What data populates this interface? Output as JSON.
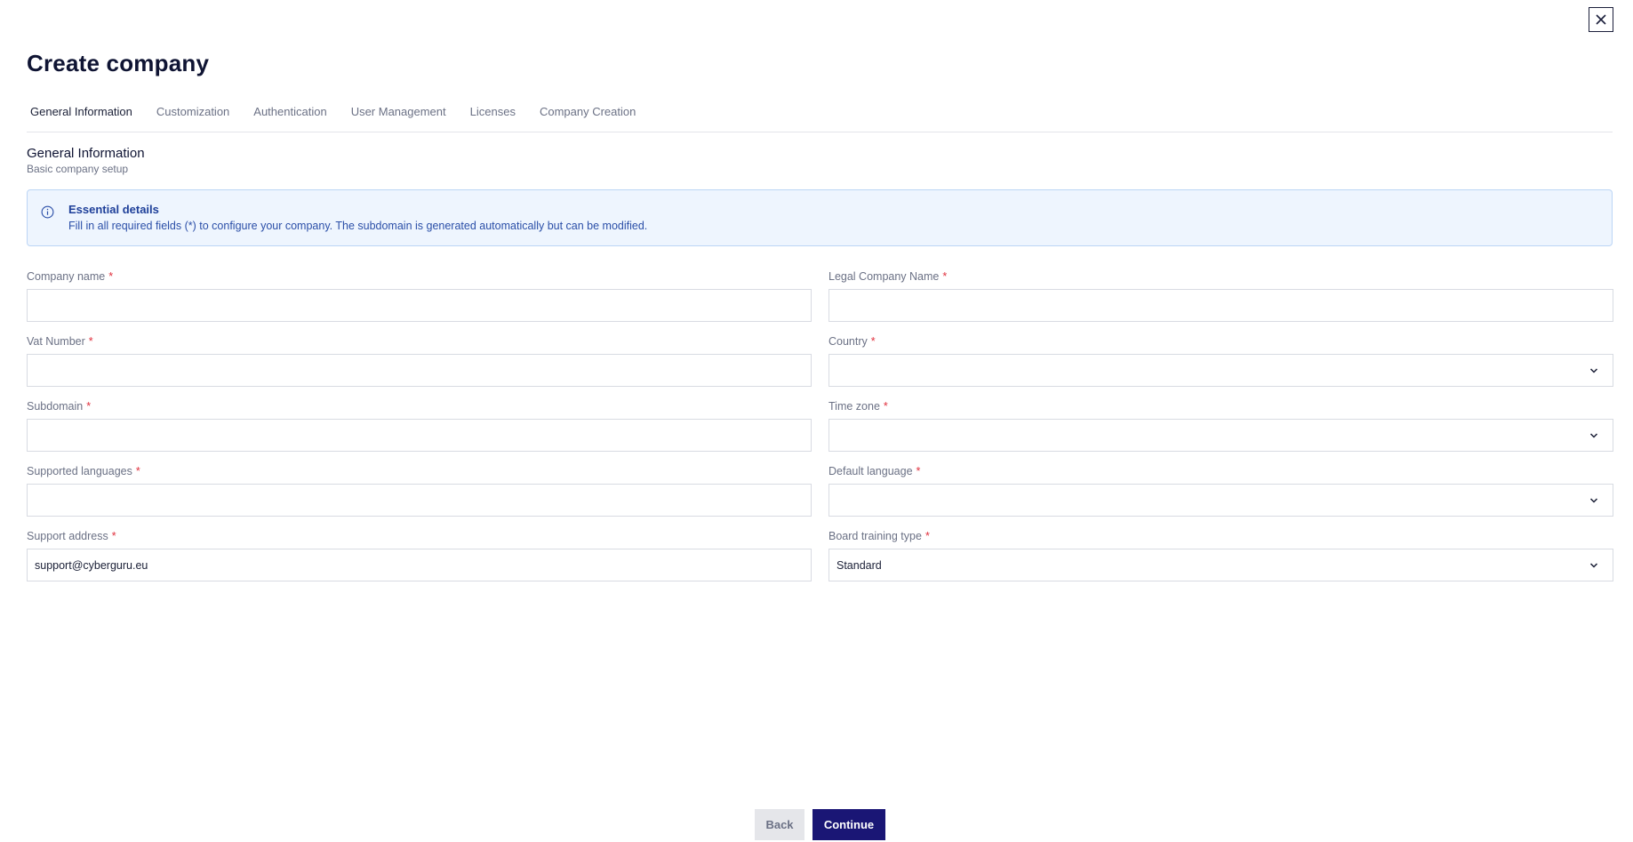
{
  "header": {
    "title": "Create company"
  },
  "tabs": [
    {
      "label": "General Information"
    },
    {
      "label": "Customization"
    },
    {
      "label": "Authentication"
    },
    {
      "label": "User Management"
    },
    {
      "label": "Licenses"
    },
    {
      "label": "Company Creation"
    }
  ],
  "section": {
    "title": "General Information",
    "subtitle": "Basic company setup"
  },
  "info": {
    "title": "Essential details",
    "text": "Fill in all required fields (*) to configure your company. The subdomain is generated automatically but can be modified."
  },
  "fields": {
    "company_name": {
      "label": "Company name",
      "value": ""
    },
    "legal_name": {
      "label": "Legal Company Name",
      "value": ""
    },
    "vat_number": {
      "label": "Vat Number",
      "value": ""
    },
    "country": {
      "label": "Country",
      "value": ""
    },
    "subdomain": {
      "label": "Subdomain",
      "value": ""
    },
    "time_zone": {
      "label": "Time zone",
      "value": ""
    },
    "supported_languages": {
      "label": "Supported languages",
      "value": ""
    },
    "default_language": {
      "label": "Default language",
      "value": ""
    },
    "support_address": {
      "label": "Support address",
      "value": "support@cyberguru.eu"
    },
    "board_training_type": {
      "label": "Board training type",
      "value": "Standard"
    }
  },
  "required_marker": "*",
  "footer": {
    "back_label": "Back",
    "continue_label": "Continue"
  },
  "colors": {
    "accent": "#1a1675",
    "info_bg": "#eef5fe",
    "required": "#e0303d"
  }
}
